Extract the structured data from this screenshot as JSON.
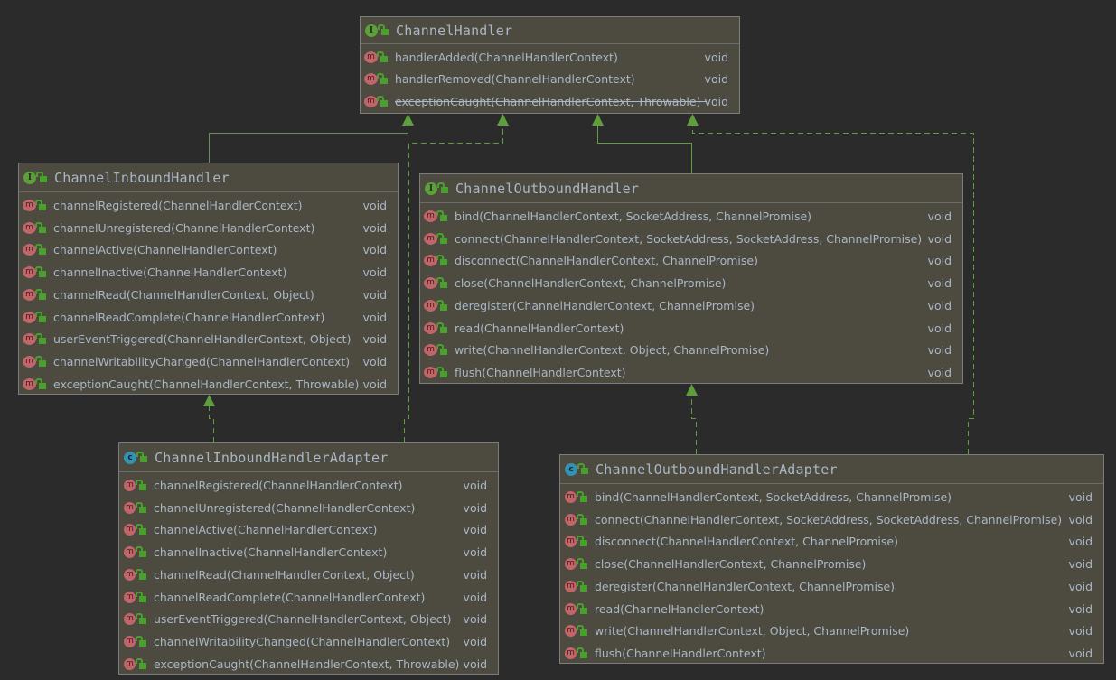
{
  "colors": {
    "background": "#2b2b2b",
    "box": "#4d4a3f",
    "text": "#a9b7c6",
    "link": "#5e9e3d",
    "interface_icon": "#5e9e3d",
    "class_icon": "#3591b0",
    "method_icon": "#c0666b"
  },
  "classes": [
    {
      "id": "ch",
      "name": "ChannelHandler",
      "kind": "interface",
      "kind_letter": "I",
      "methods": [
        {
          "name": "handlerAdded(ChannelHandlerContext)",
          "type": "void"
        },
        {
          "name": "handlerRemoved(ChannelHandlerContext)",
          "type": "void"
        },
        {
          "name": "exceptionCaught(ChannelHandlerContext, Throwable)",
          "type": "void",
          "deprecated": true
        }
      ]
    },
    {
      "id": "cih",
      "name": "ChannelInboundHandler",
      "kind": "interface",
      "kind_letter": "I",
      "methods": [
        {
          "name": "channelRegistered(ChannelHandlerContext)",
          "type": "void"
        },
        {
          "name": "channelUnregistered(ChannelHandlerContext)",
          "type": "void"
        },
        {
          "name": "channelActive(ChannelHandlerContext)",
          "type": "void"
        },
        {
          "name": "channelInactive(ChannelHandlerContext)",
          "type": "void"
        },
        {
          "name": "channelRead(ChannelHandlerContext, Object)",
          "type": "void"
        },
        {
          "name": "channelReadComplete(ChannelHandlerContext)",
          "type": "void"
        },
        {
          "name": "userEventTriggered(ChannelHandlerContext, Object)",
          "type": "void"
        },
        {
          "name": "channelWritabilityChanged(ChannelHandlerContext)",
          "type": "void"
        },
        {
          "name": "exceptionCaught(ChannelHandlerContext, Throwable)",
          "type": "void"
        }
      ]
    },
    {
      "id": "coh",
      "name": "ChannelOutboundHandler",
      "kind": "interface",
      "kind_letter": "I",
      "methods": [
        {
          "name": "bind(ChannelHandlerContext, SocketAddress, ChannelPromise)",
          "type": "void"
        },
        {
          "name": "connect(ChannelHandlerContext, SocketAddress, SocketAddress, ChannelPromise)",
          "type": "void"
        },
        {
          "name": "disconnect(ChannelHandlerContext, ChannelPromise)",
          "type": "void"
        },
        {
          "name": "close(ChannelHandlerContext, ChannelPromise)",
          "type": "void"
        },
        {
          "name": "deregister(ChannelHandlerContext, ChannelPromise)",
          "type": "void"
        },
        {
          "name": "read(ChannelHandlerContext)",
          "type": "void"
        },
        {
          "name": "write(ChannelHandlerContext, Object, ChannelPromise)",
          "type": "void"
        },
        {
          "name": "flush(ChannelHandlerContext)",
          "type": "void"
        }
      ]
    },
    {
      "id": "ciha",
      "name": "ChannelInboundHandlerAdapter",
      "kind": "class",
      "kind_letter": "c",
      "methods": [
        {
          "name": "channelRegistered(ChannelHandlerContext)",
          "type": "void"
        },
        {
          "name": "channelUnregistered(ChannelHandlerContext)",
          "type": "void"
        },
        {
          "name": "channelActive(ChannelHandlerContext)",
          "type": "void"
        },
        {
          "name": "channelInactive(ChannelHandlerContext)",
          "type": "void"
        },
        {
          "name": "channelRead(ChannelHandlerContext, Object)",
          "type": "void"
        },
        {
          "name": "channelReadComplete(ChannelHandlerContext)",
          "type": "void"
        },
        {
          "name": "userEventTriggered(ChannelHandlerContext, Object)",
          "type": "void"
        },
        {
          "name": "channelWritabilityChanged(ChannelHandlerContext)",
          "type": "void"
        },
        {
          "name": "exceptionCaught(ChannelHandlerContext, Throwable)",
          "type": "void"
        }
      ]
    },
    {
      "id": "coha",
      "name": "ChannelOutboundHandlerAdapter",
      "kind": "class",
      "kind_letter": "c",
      "methods": [
        {
          "name": "bind(ChannelHandlerContext, SocketAddress, ChannelPromise)",
          "type": "void"
        },
        {
          "name": "connect(ChannelHandlerContext, SocketAddress, SocketAddress, ChannelPromise)",
          "type": "void"
        },
        {
          "name": "disconnect(ChannelHandlerContext, ChannelPromise)",
          "type": "void"
        },
        {
          "name": "close(ChannelHandlerContext, ChannelPromise)",
          "type": "void"
        },
        {
          "name": "deregister(ChannelHandlerContext, ChannelPromise)",
          "type": "void"
        },
        {
          "name": "read(ChannelHandlerContext)",
          "type": "void"
        },
        {
          "name": "write(ChannelHandlerContext, Object, ChannelPromise)",
          "type": "void"
        },
        {
          "name": "flush(ChannelHandlerContext)",
          "type": "void"
        }
      ]
    }
  ],
  "relations": [
    {
      "from": "ChannelInboundHandler",
      "to": "ChannelHandler",
      "type": "extends"
    },
    {
      "from": "ChannelOutboundHandler",
      "to": "ChannelHandler",
      "type": "extends"
    },
    {
      "from": "ChannelInboundHandlerAdapter",
      "to": "ChannelHandler",
      "type": "implements"
    },
    {
      "from": "ChannelInboundHandlerAdapter",
      "to": "ChannelInboundHandler",
      "type": "implements"
    },
    {
      "from": "ChannelOutboundHandlerAdapter",
      "to": "ChannelHandler",
      "type": "implements"
    },
    {
      "from": "ChannelOutboundHandlerAdapter",
      "to": "ChannelOutboundHandler",
      "type": "implements"
    }
  ]
}
